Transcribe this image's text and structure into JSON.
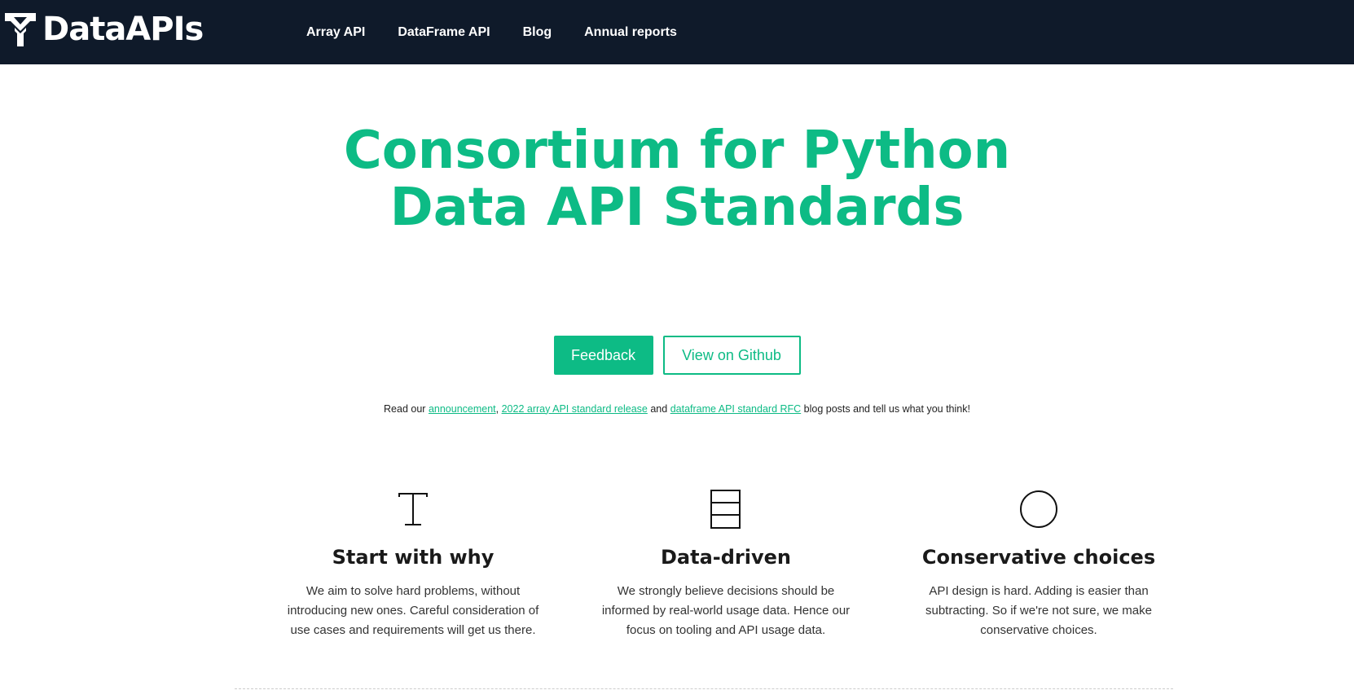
{
  "nav": {
    "logo_text": "DataAPIs",
    "links": [
      {
        "label": "Array API"
      },
      {
        "label": "DataFrame API"
      },
      {
        "label": "Blog"
      },
      {
        "label": "Annual reports"
      }
    ]
  },
  "hero": {
    "title_line1": "Consortium for Python",
    "title_line2": "Data API Standards"
  },
  "buttons": {
    "feedback": "Feedback",
    "github": "View on Github"
  },
  "notice": {
    "prefix": "Read our ",
    "link1": "announcement",
    "sep1": ", ",
    "link2": "2022 array API standard release",
    "sep2": " and ",
    "link3": "dataframe API standard RFC",
    "suffix": " blog posts and tell us what you think!"
  },
  "features": [
    {
      "icon": "text-cursor-icon",
      "title": "Start with why",
      "text": "We aim to solve hard problems, without introducing new ones. Careful consideration of use cases and requirements will get us there."
    },
    {
      "icon": "table-rows-icon",
      "title": "Data-driven",
      "text": "We strongly believe decisions should be informed by real-world usage data. Hence our focus on tooling and API usage data."
    },
    {
      "icon": "circle-icon",
      "title": "Conservative choices",
      "text": "API design is hard. Adding is easier than subtracting. So if we're not sure, we make conservative choices."
    }
  ],
  "colors": {
    "accent": "#0dbb85",
    "navbar": "#0f1a2a"
  }
}
